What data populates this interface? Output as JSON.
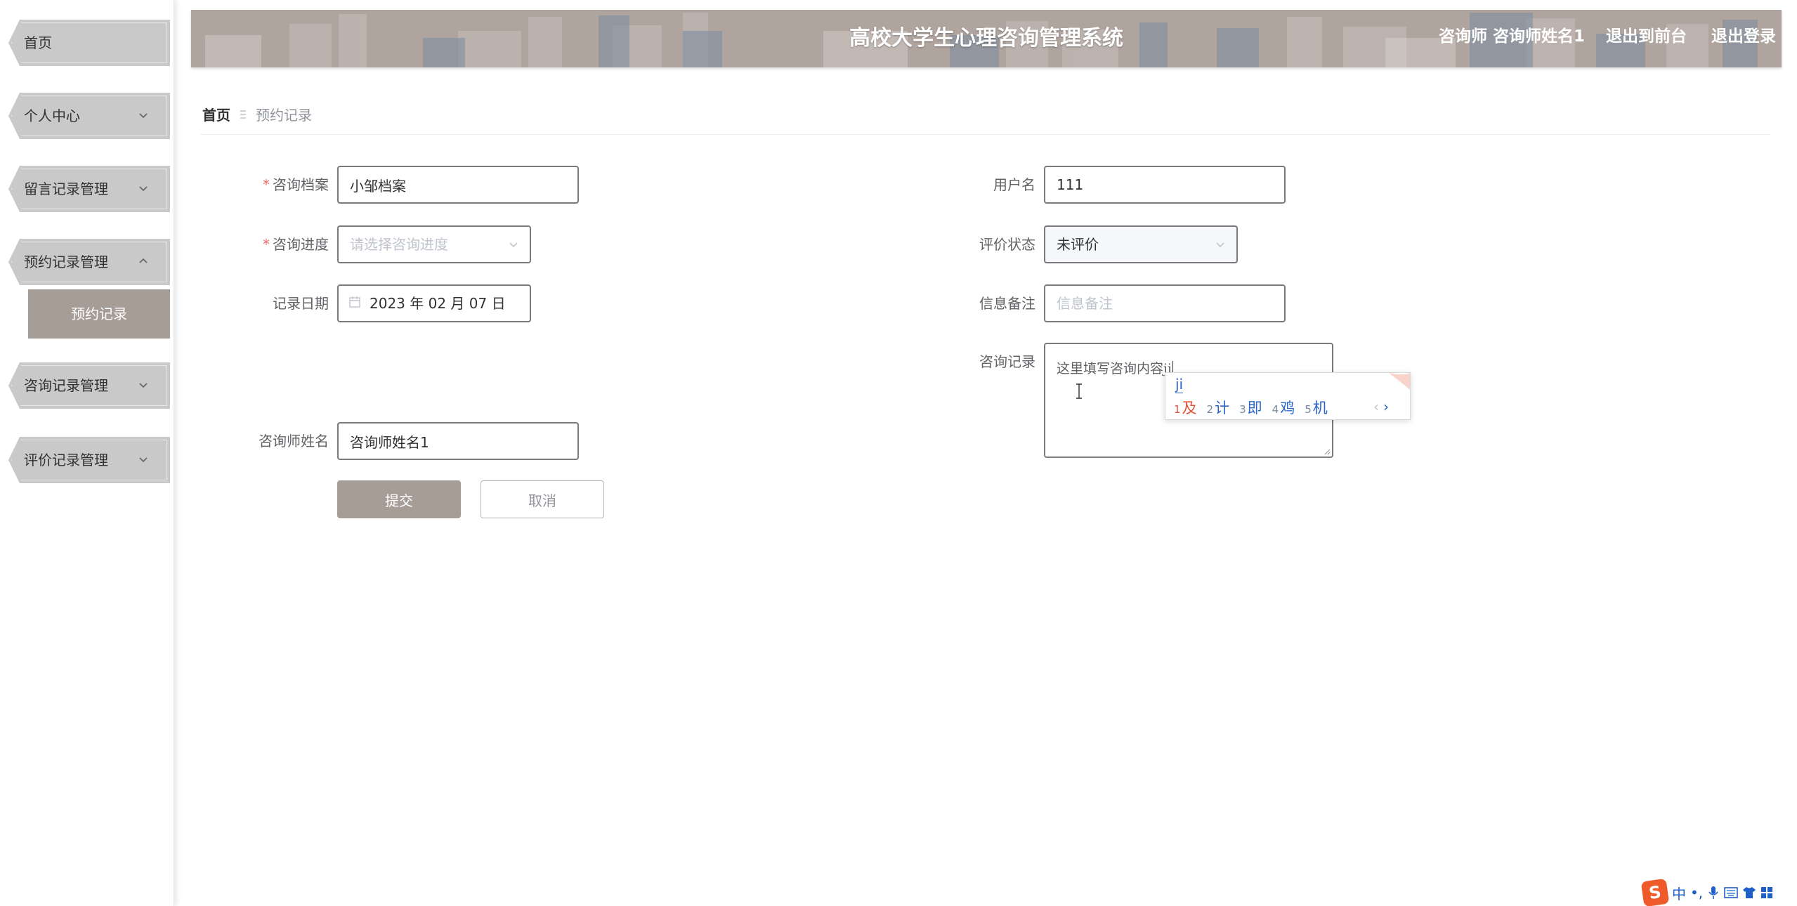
{
  "sidebar": {
    "items": [
      {
        "label": "首页",
        "icon": ""
      },
      {
        "label": "个人中心",
        "icon": "chevron-down-icon"
      },
      {
        "label": "留言记录管理",
        "icon": "chevron-down-icon"
      },
      {
        "label": "预约记录管理",
        "icon": "chevron-up-icon"
      },
      {
        "label": "咨询记录管理",
        "icon": "chevron-down-icon"
      },
      {
        "label": "评价记录管理",
        "icon": "chevron-down-icon"
      }
    ],
    "submenu": {
      "label": "预约记录"
    }
  },
  "header": {
    "title": "高校大学生心理咨询管理系统",
    "user": "咨询师 咨询师姓名1",
    "front_link": "退出到前台",
    "logout_link": "退出登录"
  },
  "breadcrumb": {
    "home": "首页",
    "current": "预约记录"
  },
  "form": {
    "archive": {
      "label": "咨询档案",
      "value": "小邹档案"
    },
    "username": {
      "label": "用户名",
      "value": "111"
    },
    "progress": {
      "label": "咨询进度",
      "placeholder": "请选择咨询进度"
    },
    "eval_status": {
      "label": "评价状态",
      "value": "未评价"
    },
    "record_date": {
      "label": "记录日期",
      "value": "2023 年 02 月 07 日"
    },
    "remark": {
      "label": "信息备注",
      "placeholder": "信息备注"
    },
    "consult_record": {
      "label": "咨询记录",
      "value": "这里填写咨询内容ji"
    },
    "counselor_name": {
      "label": "咨询师姓名",
      "value": "咨询师姓名1"
    },
    "submit_label": "提交",
    "cancel_label": "取消"
  },
  "ime_candidates": {
    "composition": "ji",
    "candidates": [
      {
        "num": "1",
        "ch": "及"
      },
      {
        "num": "2",
        "ch": "计"
      },
      {
        "num": "3",
        "ch": "即"
      },
      {
        "num": "4",
        "ch": "鸡"
      },
      {
        "num": "5",
        "ch": "机"
      }
    ],
    "prev": "‹",
    "next": "›"
  },
  "ime_status": {
    "logo": "S",
    "mode": "中",
    "punct": "•,"
  },
  "colors": {
    "accent": "#a79d97",
    "header_bg": "#b0a49e",
    "required": "#f56c6c"
  }
}
